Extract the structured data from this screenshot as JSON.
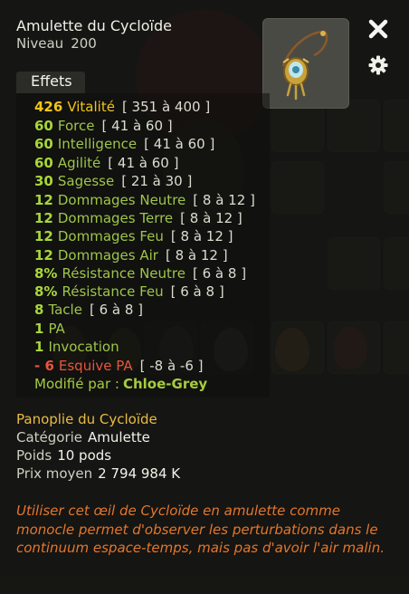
{
  "item": {
    "name": "Amulette du Cycloïde",
    "level_label": "Niveau",
    "level": "200"
  },
  "controls": {
    "close_icon": "close-icon",
    "settings_icon": "gear-icon"
  },
  "tabs": {
    "effects_label": "Effets"
  },
  "effects": [
    {
      "value": "426",
      "name": "Vitalité",
      "range": "[ 351 à 400 ]",
      "kind": "vit"
    },
    {
      "value": "60",
      "name": "Force",
      "range": "[ 41 à 60 ]",
      "kind": "pos"
    },
    {
      "value": "60",
      "name": "Intelligence",
      "range": "[ 41 à 60 ]",
      "kind": "pos"
    },
    {
      "value": "60",
      "name": "Agilité",
      "range": "[ 41 à 60 ]",
      "kind": "pos"
    },
    {
      "value": "30",
      "name": "Sagesse",
      "range": "[ 21 à 30 ]",
      "kind": "pos"
    },
    {
      "value": "12",
      "name": "Dommages Neutre",
      "range": "[ 8 à 12 ]",
      "kind": "pos"
    },
    {
      "value": "12",
      "name": "Dommages Terre",
      "range": "[ 8 à 12 ]",
      "kind": "pos"
    },
    {
      "value": "12",
      "name": "Dommages Feu",
      "range": "[ 8 à 12 ]",
      "kind": "pos"
    },
    {
      "value": "12",
      "name": "Dommages Air",
      "range": "[ 8 à 12 ]",
      "kind": "pos"
    },
    {
      "value": "8%",
      "name": "Résistance Neutre",
      "range": "[ 6 à 8 ]",
      "kind": "pos"
    },
    {
      "value": "8%",
      "name": "Résistance Feu",
      "range": "[ 6 à 8 ]",
      "kind": "pos"
    },
    {
      "value": "8",
      "name": "Tacle",
      "range": "[ 6 à 8 ]",
      "kind": "pos"
    },
    {
      "value": "1",
      "name": "PA",
      "range": "",
      "kind": "pos"
    },
    {
      "value": "1",
      "name": "Invocation",
      "range": "",
      "kind": "pos"
    },
    {
      "value": "- 6",
      "name": "Esquive PA",
      "range": "[ -8 à -6 ]",
      "kind": "neg"
    }
  ],
  "modified_by": {
    "label": "Modifié par :",
    "who": "Chloe-Grey"
  },
  "set_name": "Panoplie du Cycloïde",
  "details": {
    "category_label": "Catégorie",
    "category": "Amulette",
    "weight_label": "Poids",
    "weight": "10 pods",
    "price_label": "Prix moyen",
    "price": "2 794 984 K"
  },
  "description": "Utiliser cet œil de Cycloïde en amulette comme monocle permet d'observer les perturbations dans le continuum espace-temps, mais pas d'avoir l'air malin.",
  "colors": {
    "bonus": "#a8d63a",
    "vitality": "#f0c419",
    "malus": "#e8553d",
    "set": "#e7bd43",
    "description": "#e3762c"
  }
}
